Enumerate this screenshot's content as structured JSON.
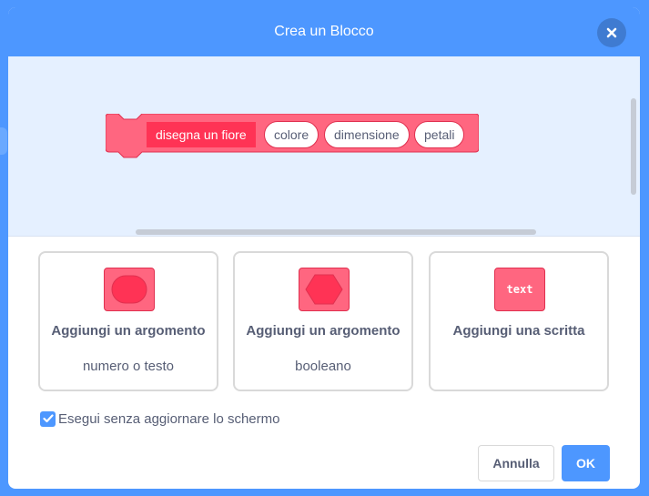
{
  "dialog": {
    "title": "Crea un Blocco",
    "close_icon": "close-icon"
  },
  "block": {
    "label": "disegna un fiore",
    "arguments": [
      "colore",
      "dimensione",
      "petali"
    ],
    "color": "#ff6680",
    "label_color": "#ff3355"
  },
  "options": [
    {
      "title": "Aggiungi un argomento",
      "subtitle": "numero o testo",
      "icon": "number-text-input-icon"
    },
    {
      "title": "Aggiungi un argomento",
      "subtitle": "booleano",
      "icon": "boolean-input-icon"
    },
    {
      "title": "Aggiungi una scritta",
      "subtitle": "",
      "icon": "text-label-icon",
      "icon_text": "text"
    }
  ],
  "run_without_refresh": {
    "label": "Esegui senza aggiornare lo schermo",
    "checked": true
  },
  "buttons": {
    "cancel": "Annulla",
    "ok": "OK"
  },
  "colors": {
    "accent": "#4d97ff",
    "text": "#575e75",
    "canvas_bg": "#e5f0ff"
  }
}
